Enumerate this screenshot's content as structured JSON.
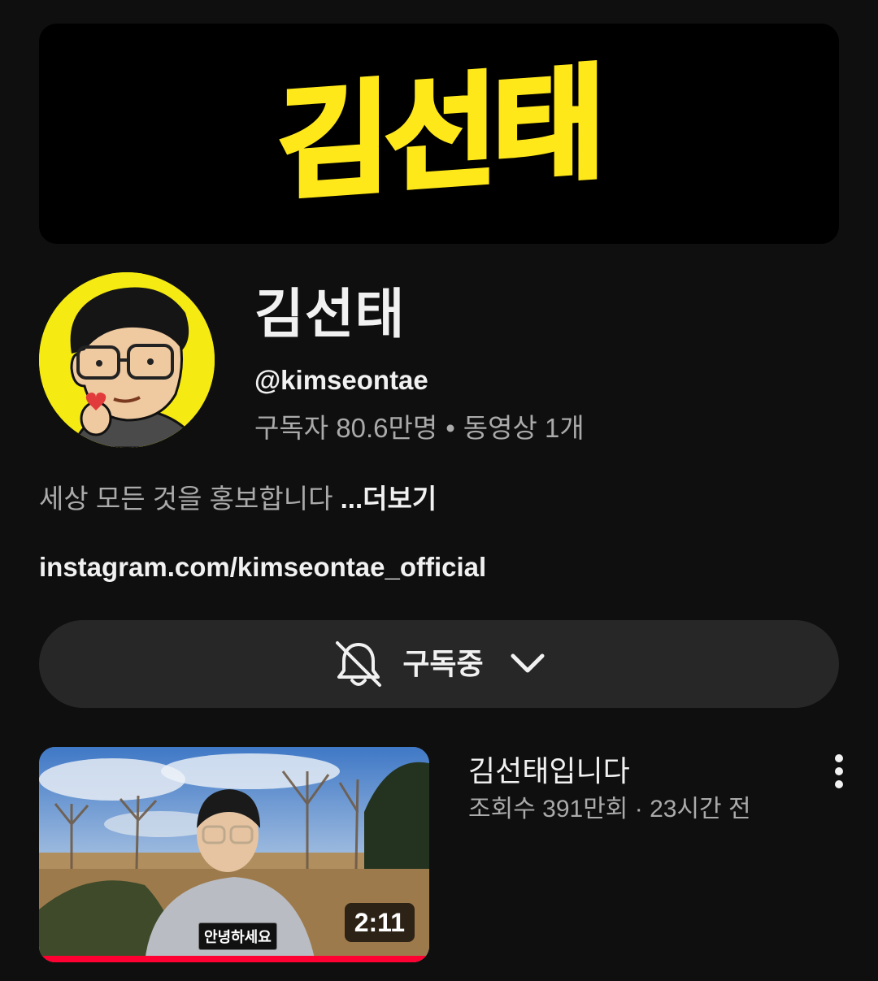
{
  "banner": {
    "logo_text": "김선태",
    "logo_color": "#ffe81a"
  },
  "channel": {
    "name": "김선태",
    "handle": "@kimseontae",
    "subscribers": "구독자 80.6만명",
    "separator": "•",
    "videos": "동영상 1개",
    "description": "세상 모든 것을 홍보합니다",
    "more_label": "...더보기",
    "link": "instagram.com/kimseontae_official"
  },
  "subscribe": {
    "label": "구독중",
    "bell_icon": "bell-off-icon",
    "chevron_icon": "chevron-down-icon"
  },
  "video": {
    "title": "김선태입니다",
    "views": "조회수 391만회",
    "separator": "·",
    "age": "23시간 전",
    "duration": "2:11",
    "caption": "안녕하세요",
    "progress_fraction": 1.0,
    "accent": "#ff0033"
  }
}
